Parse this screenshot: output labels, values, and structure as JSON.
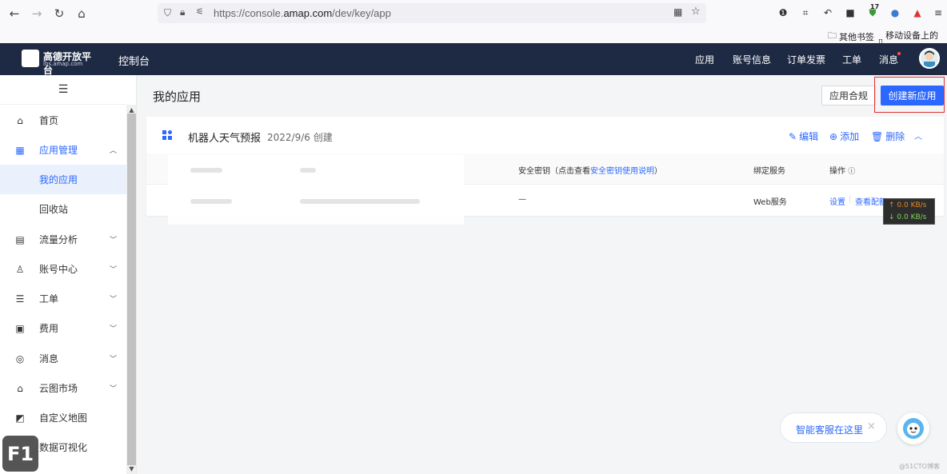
{
  "browser": {
    "url_prefix": "https://console.",
    "url_domain": "amap.com",
    "url_path": "/dev/key/app",
    "ext_badge": "17",
    "bookmarks": [
      "其他书签",
      "移动设备上的书签"
    ]
  },
  "header": {
    "logo_title": "高德开放平台",
    "logo_sub": "lbs.amap.com",
    "console": "控制台",
    "nav": [
      "应用",
      "账号信息",
      "订单发票",
      "工单",
      "消息"
    ]
  },
  "sidebar": {
    "toggle": "☰",
    "items": [
      {
        "label": "首页",
        "icon": "home-icon"
      },
      {
        "label": "应用管理",
        "icon": "apps-icon"
      },
      {
        "label": "我的应用"
      },
      {
        "label": "回收站"
      },
      {
        "label": "流量分析",
        "icon": "chart-icon"
      },
      {
        "label": "账号中心",
        "icon": "user-icon"
      },
      {
        "label": "工单",
        "icon": "ticket-icon"
      },
      {
        "label": "费用",
        "icon": "fee-icon"
      },
      {
        "label": "消息",
        "icon": "message-icon"
      },
      {
        "label": "云图市场",
        "icon": "market-icon"
      },
      {
        "label": "自定义地图",
        "icon": "custom-map-icon"
      },
      {
        "label": "数据可视化",
        "icon": "visualization-icon"
      }
    ]
  },
  "main": {
    "title": "我的应用",
    "compliance_btn": "应用合规",
    "create_btn": "创建新应用",
    "app": {
      "name": "机器人天气预报",
      "date": "2022/9/6 创建",
      "actions": [
        "编辑",
        "添加",
        "删除"
      ]
    },
    "table": {
      "col_secret_prefix": "安全密钥（点击查看",
      "col_secret_link": "安全密钥使用说明",
      "col_secret_suffix": "）",
      "col_bind": "绑定服务",
      "col_ops": "操作",
      "row": {
        "secret": "—",
        "bind": "Web服务",
        "op_settings": "设置",
        "op_view": "查看配额"
      }
    }
  },
  "network": {
    "up": "↑ 0.0 KB/s",
    "down": "↓ 0.0 KB/s"
  },
  "chat": {
    "label": "智能客服在这里",
    "close": "×"
  },
  "overlay": {
    "f1": "F1",
    "watermark": "@51CTO博客"
  },
  "colors": {
    "brand": "#2c68ff",
    "header": "#1e2a44",
    "highlight": "#e0312f"
  }
}
